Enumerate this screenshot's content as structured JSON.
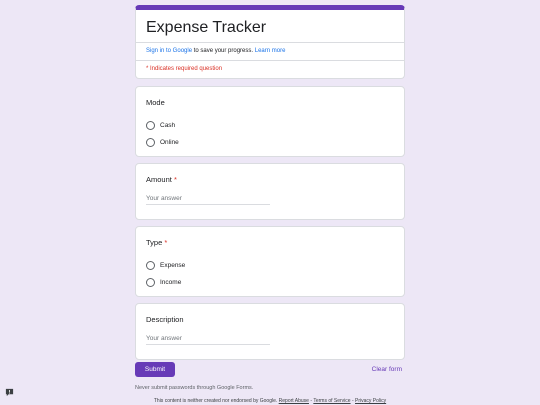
{
  "form": {
    "title": "Expense Tracker",
    "signin_link": "Sign in to Google",
    "signin_text": " to save your progress. ",
    "learn_more": "Learn more",
    "required_note": "* Indicates required question"
  },
  "questions": {
    "mode": {
      "label": "Mode",
      "options": [
        "Cash",
        "Online"
      ]
    },
    "amount": {
      "label": "Amount",
      "required": "*",
      "placeholder": "Your answer"
    },
    "type": {
      "label": "Type",
      "required": "*",
      "options": [
        "Expense",
        "Income"
      ]
    },
    "description": {
      "label": "Description",
      "placeholder": "Your answer"
    }
  },
  "actions": {
    "submit": "Submit",
    "clear": "Clear form"
  },
  "footer": {
    "never": "Never submit passwords through Google Forms.",
    "notice": "This content is neither created nor endorsed by Google. ",
    "report_abuse": "Report Abuse",
    "sep1": " - ",
    "terms": "Terms of Service",
    "sep2": " - ",
    "privacy": "Privacy Policy"
  },
  "colors": {
    "accent": "#673ab7",
    "background": "#ede7f6",
    "required": "#d93025",
    "link": "#1a73e8"
  },
  "icons": {
    "report": "report-problem-icon"
  }
}
